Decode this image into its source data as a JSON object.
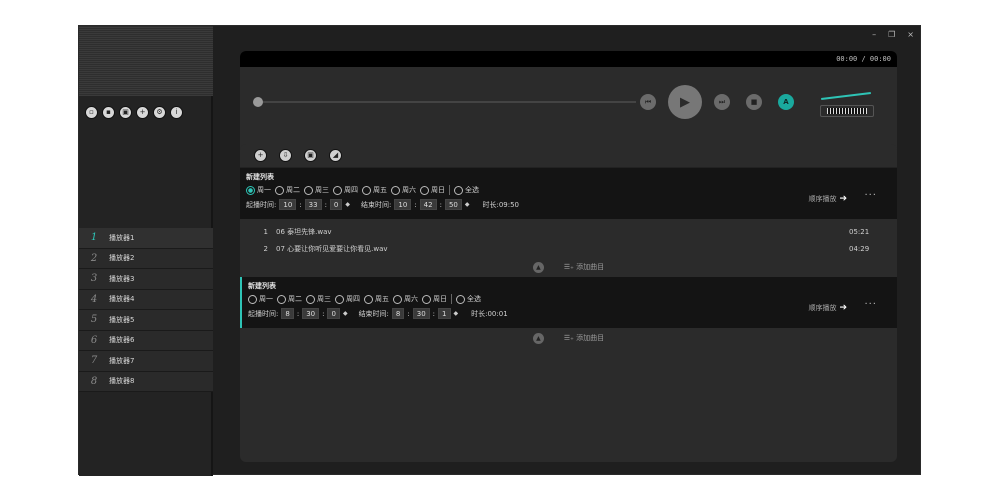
{
  "window": {
    "minimize": "–",
    "restore": "❐",
    "close": "×"
  },
  "sidebar": {
    "tools": [
      {
        "icon": "new-file-icon",
        "glyph": "▫"
      },
      {
        "icon": "copy-icon",
        "glyph": "▪"
      },
      {
        "icon": "save-icon",
        "glyph": "▣"
      },
      {
        "icon": "add-icon",
        "glyph": "+"
      },
      {
        "icon": "settings-icon",
        "glyph": "⚙"
      },
      {
        "icon": "info-icon",
        "glyph": "i"
      }
    ],
    "players": [
      {
        "num": "1",
        "name": "播放器1"
      },
      {
        "num": "2",
        "name": "播放器2"
      },
      {
        "num": "3",
        "name": "播放器3"
      },
      {
        "num": "4",
        "name": "播放器4"
      },
      {
        "num": "5",
        "name": "播放器5"
      },
      {
        "num": "6",
        "name": "播放器6"
      },
      {
        "num": "7",
        "name": "播放器7"
      },
      {
        "num": "8",
        "name": "播放器8"
      }
    ]
  },
  "player": {
    "time_display": "00:00  /  00:00",
    "progress": 0,
    "controls": {
      "prev": "⏮",
      "play": "▶",
      "next": "⏭",
      "stop": "■",
      "ab": "A"
    }
  },
  "toolbar": [
    {
      "icon": "add-list-icon",
      "glyph": "+"
    },
    {
      "icon": "import-icon",
      "glyph": "⇩"
    },
    {
      "icon": "save-list-icon",
      "glyph": "▣"
    },
    {
      "icon": "clear-icon",
      "glyph": "◢"
    }
  ],
  "playlists": [
    {
      "title": "新建列表",
      "days": [
        {
          "label": "周一",
          "checked": true
        },
        {
          "label": "周二",
          "checked": false
        },
        {
          "label": "周三",
          "checked": false
        },
        {
          "label": "周四",
          "checked": false
        },
        {
          "label": "周五",
          "checked": false
        },
        {
          "label": "周六",
          "checked": false
        },
        {
          "label": "周日",
          "checked": false
        }
      ],
      "select_all": "全选",
      "start_label": "起播时间:",
      "start": [
        "10",
        "33",
        "0"
      ],
      "end_label": "结束时间:",
      "end": [
        "10",
        "42",
        "50"
      ],
      "duration": "时长:09:50",
      "order": "顺序播放",
      "more": "···",
      "tracks": [
        {
          "idx": "1",
          "title": "06 泰坦先锋.wav",
          "dur": "05:21"
        },
        {
          "idx": "2",
          "title": "07 心要让你听见爱要让你看见.wav",
          "dur": "04:29"
        }
      ],
      "add_track": "添加曲目"
    },
    {
      "title": "新建列表",
      "days": [
        {
          "label": "周一",
          "checked": false
        },
        {
          "label": "周二",
          "checked": false
        },
        {
          "label": "周三",
          "checked": false
        },
        {
          "label": "周四",
          "checked": false
        },
        {
          "label": "周五",
          "checked": false
        },
        {
          "label": "周六",
          "checked": false
        },
        {
          "label": "周日",
          "checked": false
        }
      ],
      "select_all": "全选",
      "start_label": "起播时间:",
      "start": [
        "8",
        "30",
        "0"
      ],
      "end_label": "结束时间:",
      "end": [
        "8",
        "30",
        "1"
      ],
      "duration": "时长:00:01",
      "order": "顺序播放",
      "more": "···",
      "tracks": [],
      "add_track": "添加曲目"
    }
  ],
  "colors": {
    "accent": "#2ec4b6",
    "panel": "#2b2b2b",
    "background": "#1f1f1f"
  }
}
